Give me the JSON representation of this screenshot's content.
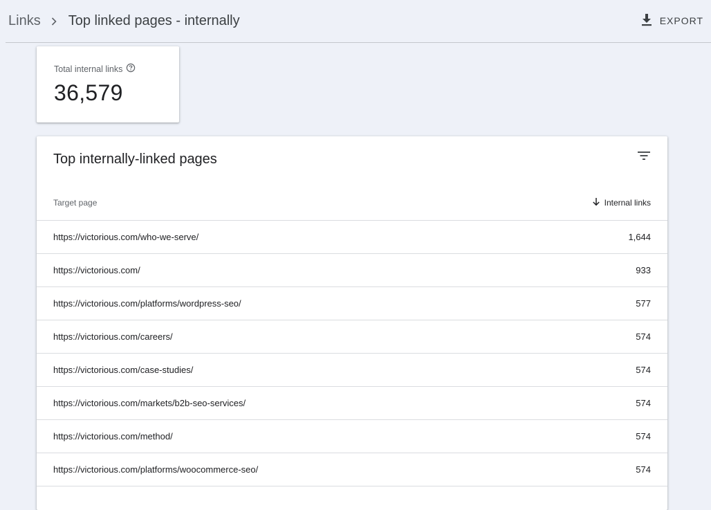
{
  "header": {
    "breadcrumb_root": "Links",
    "breadcrumb_current": "Top linked pages - internally",
    "export_label": "EXPORT"
  },
  "stat": {
    "label": "Total internal links",
    "value": "36,579"
  },
  "table": {
    "title": "Top internally-linked pages",
    "columns": {
      "target": "Target page",
      "links": "Internal links"
    },
    "sort": "descending",
    "rows": [
      {
        "url": "https://victorious.com/who-we-serve/",
        "links": "1,644"
      },
      {
        "url": "https://victorious.com/",
        "links": "933"
      },
      {
        "url": "https://victorious.com/platforms/wordpress-seo/",
        "links": "577"
      },
      {
        "url": "https://victorious.com/careers/",
        "links": "574"
      },
      {
        "url": "https://victorious.com/case-studies/",
        "links": "574"
      },
      {
        "url": "https://victorious.com/markets/b2b-seo-services/",
        "links": "574"
      },
      {
        "url": "https://victorious.com/method/",
        "links": "574"
      },
      {
        "url": "https://victorious.com/platforms/woocommerce-seo/",
        "links": "574"
      }
    ]
  },
  "icons": {
    "breadcrumb_separator": "chevron-right-icon",
    "export": "download-icon",
    "help": "help-circle-icon",
    "filter": "filter-icon",
    "sort": "arrow-down-icon"
  },
  "colors": {
    "background": "#eef1f8",
    "card": "#ffffff",
    "divider": "#dadce0",
    "text_primary": "#202124",
    "text_secondary": "#5f6368"
  }
}
